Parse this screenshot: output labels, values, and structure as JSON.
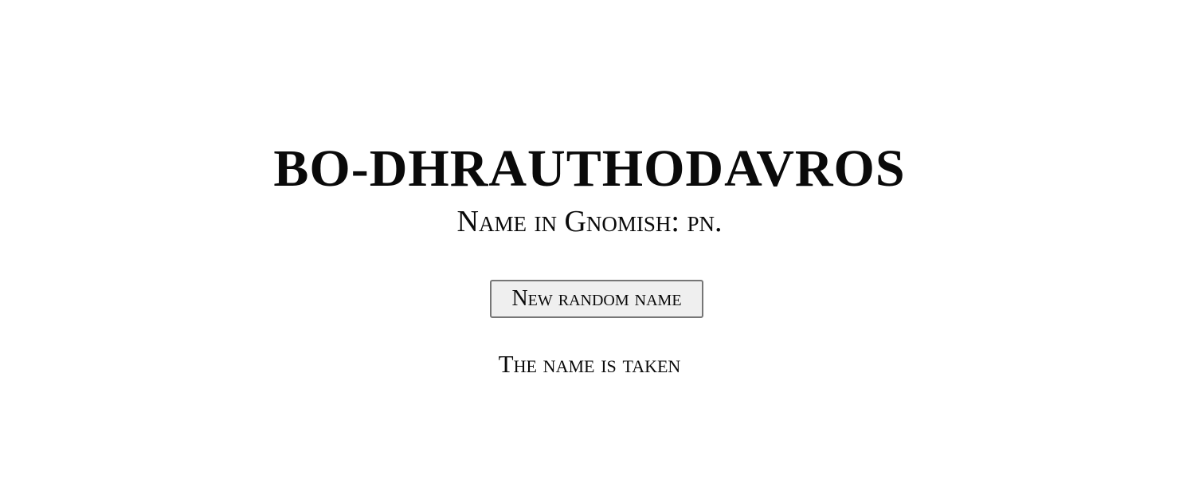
{
  "name_generator": {
    "generated_name": "BO-DHRAUTHODAVROS",
    "subtitle": "Name in Gnomish: pn.",
    "new_name_button_label": "New random name",
    "availability_status": "The name is taken"
  },
  "colors": {
    "text": "#0a0a0a",
    "background": "#ffffff",
    "button_background": "#efefef",
    "button_border": "#767676"
  }
}
